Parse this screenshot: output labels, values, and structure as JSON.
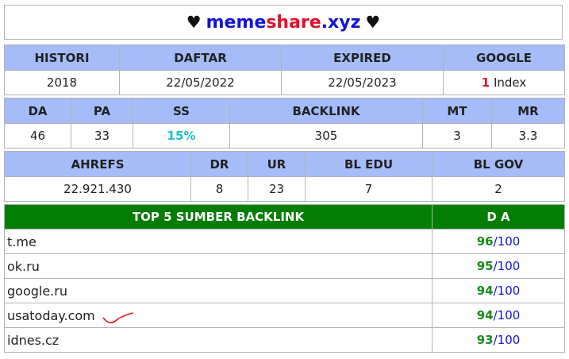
{
  "title": {
    "heart": "♥",
    "part1": "meme",
    "part2": "share",
    "part3": ".xyz"
  },
  "row1": {
    "headers": [
      "HISTORI",
      "DAFTAR",
      "EXPIRED",
      "GOOGLE"
    ],
    "histori": "2018",
    "daftar": "22/05/2022",
    "expired": "22/05/2023",
    "google_count": "1",
    "google_label": "Index"
  },
  "row2": {
    "headers": [
      "DA",
      "PA",
      "SS",
      "BACKLINK",
      "MT",
      "MR"
    ],
    "values": [
      "46",
      "33",
      "15%",
      "305",
      "3",
      "3.3"
    ]
  },
  "row3": {
    "headers": [
      "AHREFS",
      "DR",
      "UR",
      "BL EDU",
      "BL GOV"
    ],
    "values": [
      "22.921.430",
      "8",
      "23",
      "7",
      "2"
    ]
  },
  "backlinks": {
    "header_site": "TOP 5 SUMBER BACKLINK",
    "header_da": "D A",
    "rows": [
      {
        "site": "t.me",
        "da": "96",
        "max": "/100"
      },
      {
        "site": "ok.ru",
        "da": "95",
        "max": "/100"
      },
      {
        "site": "google.ru",
        "da": "94",
        "max": "/100"
      },
      {
        "site": "usatoday.com",
        "da": "94",
        "max": "/100"
      },
      {
        "site": "idnes.cz",
        "da": "93",
        "max": "/100"
      }
    ]
  },
  "colors": {
    "header_bg": "#a6bcf8",
    "backlink_header_bg": "#037d03",
    "brand_blue": "#1414d8",
    "brand_red": "#e0102a",
    "ss_teal": "#18c2c9",
    "da_green": "#1a8a1a"
  }
}
